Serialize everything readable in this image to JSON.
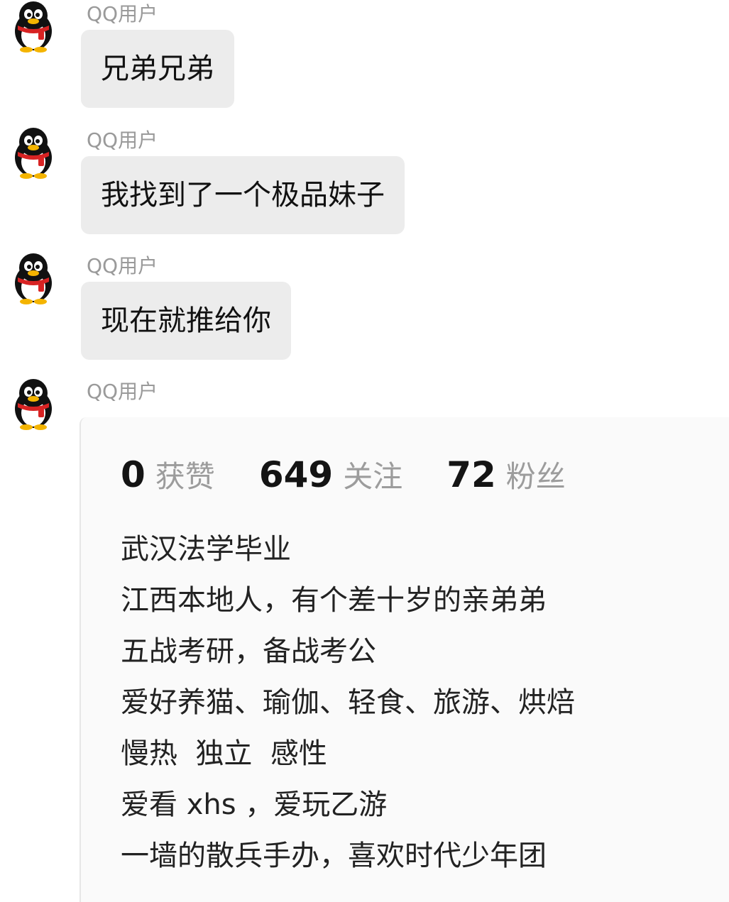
{
  "messages": [
    {
      "sender": "QQ用户",
      "text": "兄弟兄弟"
    },
    {
      "sender": "QQ用户",
      "text": "我找到了一个极品妹子"
    },
    {
      "sender": "QQ用户",
      "text": "现在就推给你"
    },
    {
      "sender": "QQ用户"
    }
  ],
  "profile_card": {
    "stats": [
      {
        "value": "0",
        "label": "获赞"
      },
      {
        "value": "649",
        "label": "关注"
      },
      {
        "value": "72",
        "label": "粉丝"
      }
    ],
    "bio": [
      "武汉法学毕业",
      "江西本地人，有个差十岁的亲弟弟",
      "五战考研，备战考公",
      "爱好养猫、瑜伽、轻食、旅游、烘焙",
      "慢热  独立  感性",
      "爱看 xhs ，爱玩乙游",
      "一墙的散兵手办，喜欢时代少年团"
    ]
  },
  "icons": {
    "avatar": "qq-penguin-icon"
  },
  "colors": {
    "bubble": "#ececec",
    "sender_text": "#9a9a9a",
    "stat_label": "#9c9c9c",
    "card_bg": "#fafafa"
  }
}
